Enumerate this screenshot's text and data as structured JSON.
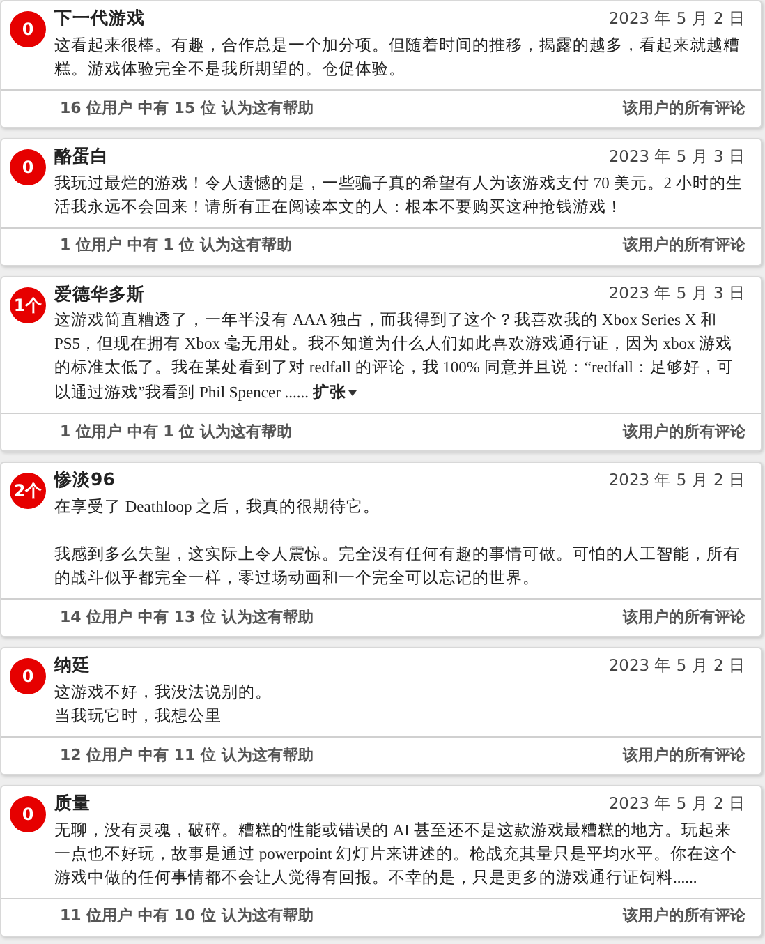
{
  "reviews": [
    {
      "badge": "0",
      "user": "下一代游戏",
      "date": "2023 年 5 月 2 日",
      "body": "这看起来很棒。有趣，合作总是一个加分项。但随着时间的推移，揭露的越多，看起来就越糟糕。游戏体验完全不是我所期望的。仓促体验。",
      "helpful": "16 位用户 中有 15 位 认为这有帮助",
      "all_reviews": "该用户的所有评论"
    },
    {
      "badge": "0",
      "user": "酪蛋白",
      "date": "2023 年 5 月 3 日",
      "body": "我玩过最烂的游戏！令人遗憾的是，一些骗子真的希望有人为该游戏支付 70 美元。2 小时的生活我永远不会回来！请所有正在阅读本文的人：根本不要购买这种抢钱游戏！",
      "helpful": "1 位用户 中有 1 位 认为这有帮助",
      "all_reviews": "该用户的所有评论"
    },
    {
      "badge": "1个",
      "user": "爱德华多斯",
      "date": "2023 年 5 月 3 日",
      "body": "这游戏简直糟透了，一年半没有 AAA 独占，而我得到了这个？我喜欢我的 Xbox Series X 和 PS5，但现在拥有 Xbox 毫无用处。我不知道为什么人们如此喜欢游戏通行证，因为 xbox 游戏的标准太低了。我在某处看到了对 redfall 的评论，我 100% 同意并且说：“redfall：足够好，可以通过游戏”我看到 Phil Spencer ......",
      "expand": "扩张",
      "helpful": "1 位用户 中有 1 位 认为这有帮助",
      "all_reviews": "该用户的所有评论"
    },
    {
      "badge": "2个",
      "user": "惨淡96",
      "date": "2023 年 5 月 2 日",
      "body": [
        {
          "lines": [
            "在享受了 Deathloop 之后，我真的很期待它。"
          ]
        },
        {
          "lines": [
            "我感到多么失望，这实际上令人震惊。完全没有任何有趣的事情可做。可怕的人工智能，所有的战斗似乎都完全一样，零过场动画和一个完全可以忘记的世界。"
          ]
        }
      ],
      "helpful": "14 位用户 中有 13 位 认为这有帮助",
      "all_reviews": "该用户的所有评论"
    },
    {
      "badge": "0",
      "user": "纳廷",
      "date": "2023 年 5 月 2 日",
      "body": [
        {
          "lines": [
            "这游戏不好，我没法说别的。",
            "当我玩它时，我想公里"
          ]
        }
      ],
      "helpful": "12 位用户 中有 11 位 认为这有帮助",
      "all_reviews": "该用户的所有评论"
    },
    {
      "badge": "0",
      "user": "质量",
      "date": "2023 年 5 月 2 日",
      "body": "无聊，没有灵魂，破碎。糟糕的性能或错误的 AI 甚至还不是这款游戏最糟糕的地方。玩起来一点也不好玩，故事是通过 powerpoint 幻灯片来讲述的。枪战充其量只是平均水平。你在这个游戏中做的任何事情都不会让人觉得有回报。不幸的是，只是更多的游戏通行证饲料......",
      "helpful": "11 位用户 中有 10 位 认为这有帮助",
      "all_reviews": "该用户的所有评论"
    }
  ]
}
